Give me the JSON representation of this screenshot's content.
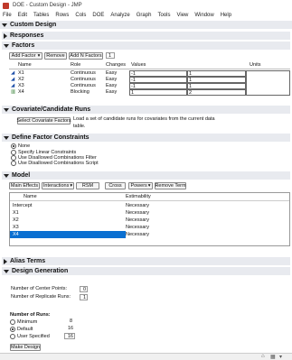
{
  "window": {
    "title": "DOE - Custom Design - JMP"
  },
  "menu": [
    "File",
    "Edit",
    "Tables",
    "Rows",
    "Cols",
    "DOE",
    "Analyze",
    "Graph",
    "Tools",
    "View",
    "Window",
    "Help"
  ],
  "outline": {
    "custom_design": "Custom Design",
    "responses": "Responses",
    "factors": "Factors",
    "covariate": "Covariate/Candidate Runs",
    "constraints": "Define Factor Constraints",
    "model": "Model",
    "alias_terms": "Alias Terms",
    "design_generation": "Design Generation"
  },
  "factors": {
    "add_factor_label": "Add Factor",
    "remove_label": "Remove",
    "add_n_label": "Add N Factors",
    "n_value": "1",
    "headers": {
      "name": "Name",
      "role": "Role",
      "changes": "Changes",
      "values": "Values",
      "units": "Units"
    },
    "rows": [
      {
        "name": "X1",
        "role": "Continuous",
        "changes": "Easy",
        "low": "-1",
        "high": "1"
      },
      {
        "name": "X2",
        "role": "Continuous",
        "changes": "Easy",
        "low": "-1",
        "high": "1"
      },
      {
        "name": "X3",
        "role": "Continuous",
        "changes": "Easy",
        "low": "-1",
        "high": "1"
      },
      {
        "name": "X4",
        "role": "Blocking",
        "changes": "Easy",
        "low": "1",
        "high": "2"
      }
    ]
  },
  "covariate": {
    "button_label": "Select Covariate Factors",
    "description_1": "Load a set of candidate runs for covariates from the current data",
    "description_2": "table."
  },
  "constraints": {
    "options": [
      "None",
      "Specify Linear Constraints",
      "Use Disallowed Combinations Filter",
      "Use Disallowed Combinations Script"
    ],
    "selected": "None"
  },
  "model": {
    "buttons": {
      "main_effects": "Main Effects",
      "interactions": "Interactions",
      "rsm": "RSM",
      "cross": "Cross",
      "powers": "Powers",
      "remove_term": "Remove Term"
    },
    "headers": {
      "name": "Name",
      "estimability": "Estimability"
    },
    "terms": [
      {
        "name": "Intercept",
        "est": "Necessary"
      },
      {
        "name": "X1",
        "est": "Necessary"
      },
      {
        "name": "X2",
        "est": "Necessary"
      },
      {
        "name": "X3",
        "est": "Necessary"
      },
      {
        "name": "X4",
        "est": "Necessary"
      }
    ]
  },
  "design_generation": {
    "center_points_label": "Number of Center Points:",
    "center_points_value": "0",
    "replicate_label": "Number of Replicate Runs:",
    "replicate_value": "1",
    "runs_label": "Number of Runs:",
    "minimum_label": "Minimum",
    "minimum_value": "8",
    "default_label": "Default",
    "default_value": "16",
    "user_label": "User Specified",
    "user_value": "16",
    "make_design_label": "Make Design"
  }
}
